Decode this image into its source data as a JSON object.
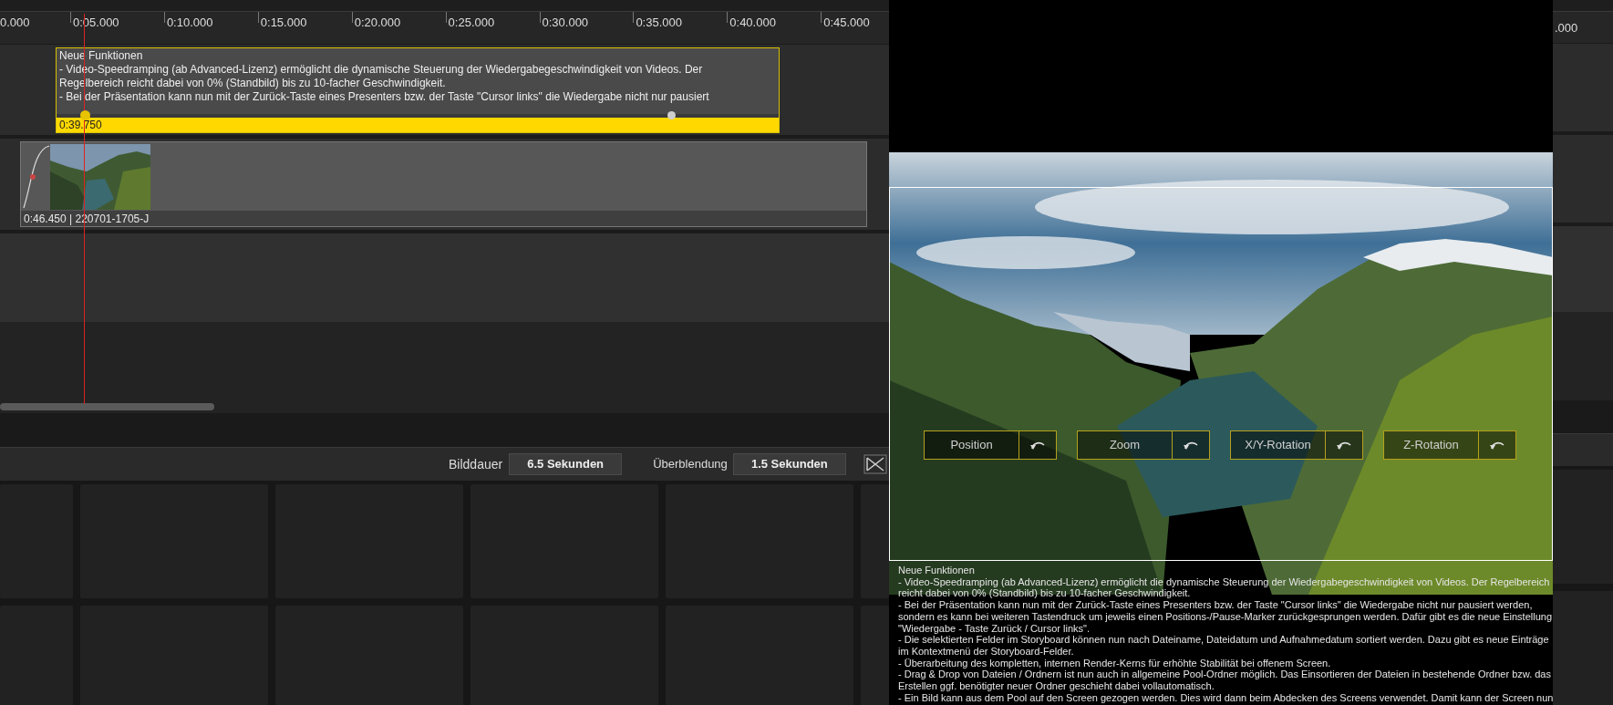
{
  "ruler": {
    "labels": [
      "0.000",
      "0:05.000",
      "0:10.000",
      "0:15.000",
      "0:20.000",
      "0:25.000",
      "0:30.000",
      "0:35.000",
      "0:40.000",
      "0:45.000"
    ],
    "right_label": ".000"
  },
  "text_clip": {
    "lines": [
      "Neue Funktionen",
      "- Video-Speedramping (ab Advanced-Lizenz) ermöglicht die dynamische Steuerung der Wiedergabegeschwindigkeit von Videos. Der",
      "Regelbereich reicht dabei von 0% (Standbild) bis zu 10-facher Geschwindigkeit.",
      "- Bei der Präsentation kann nun mit der Zurück-Taste eines Presenters bzw. der Taste \"Cursor links\" die Wiedergabe nicht nur pausiert"
    ],
    "time": "0:39.750"
  },
  "image_clip": {
    "label": "0:46.450 | 220701-1705-J"
  },
  "toolbar": {
    "duration": {
      "label": "Bilddauer",
      "value": "6.5 Sekunden"
    },
    "transition": {
      "label": "Überblendung",
      "value": "1.5 Sekunden"
    }
  },
  "preview": {
    "buttons": [
      {
        "label": "Position"
      },
      {
        "label": "Zoom"
      },
      {
        "label": "X/Y-Rotation"
      },
      {
        "label": "Z-Rotation"
      }
    ],
    "caption_lines": [
      "Neue Funktionen",
      "- Video-Speedramping (ab Advanced-Lizenz) ermöglicht die dynamische Steuerung der Wiedergabegeschwindigkeit von Videos. Der Regelbereich",
      "reicht dabei von 0% (Standbild) bis zu 10-facher Geschwindigkeit.",
      "- Bei der Präsentation kann nun mit der Zurück-Taste eines Presenters bzw. der Taste \"Cursor links\" die Wiedergabe nicht nur pausiert werden,",
      "sondern es kann bei weiteren Tastendruck um jeweils einen Positions-/Pause-Marker zurückgesprungen werden. Dafür gibt es die neue Einstellung",
      "\"Wiedergabe - Taste Zurück / Cursor links\".",
      "- Die selektierten Felder im Storyboard können nun nach Dateiname, Dateidatum und Aufnahmedatum sortiert werden. Dazu gibt es neue Einträge",
      "im Kontextmenü der Storyboard-Felder.",
      "- Überarbeitung des kompletten, internen Render-Kerns für erhöhte Stabilität bei offenem Screen.",
      "- Drag & Drop von Dateien / Ordnern ist nun auch in allgemeine Pool-Ordner möglich. Das Einsortieren der Dateien in bestehende Ordner bzw. das",
      "Erstellen ggf. benötigter neuer Ordner geschieht dabei vollautomatisch.",
      "- Ein Bild kann aus dem Pool auf den Screen gezogen werden. Dies wird dann beim Abdecken des Screens verwendet. Damit kann der Screen nun"
    ]
  }
}
